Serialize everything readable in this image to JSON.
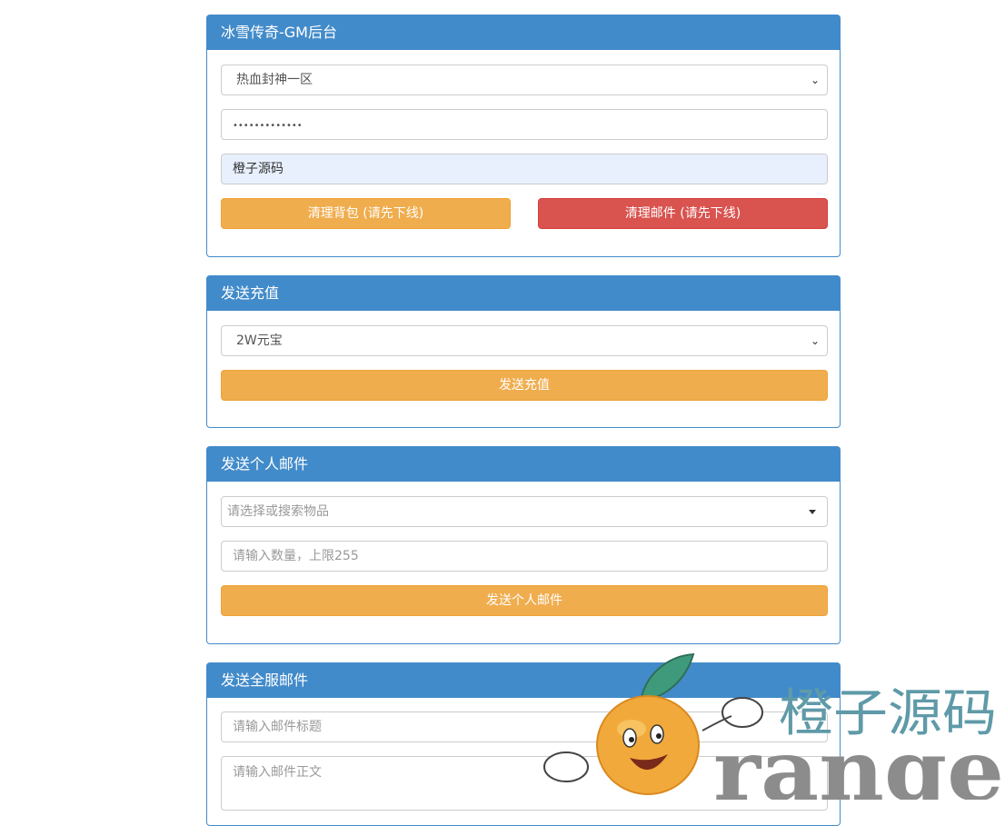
{
  "panel1": {
    "title": "冰雪传奇-GM后台",
    "server_select": "热血封神一区",
    "password_value": "•••••••••••••",
    "username_value": "橙子源码",
    "clear_bag_label": "清理背包 (请先下线)",
    "clear_mail_label": "清理邮件 (请先下线)"
  },
  "panel2": {
    "title": "发送充值",
    "recharge_select": "2W元宝",
    "send_label": "发送充值"
  },
  "panel3": {
    "title": "发送个人邮件",
    "item_select_placeholder": "请选择或搜索物品",
    "quantity_placeholder": "请输入数量，上限255",
    "send_label": "发送个人邮件"
  },
  "panel4": {
    "title": "发送全服邮件",
    "mail_title_placeholder": "请输入邮件标题",
    "mail_body_placeholder": "请输入邮件正文"
  },
  "watermark": {
    "cn_text": "橙子源码",
    "en_text": "range"
  },
  "colors": {
    "primary": "#428bca",
    "warning": "#f0ad4e",
    "danger": "#d9534f"
  }
}
